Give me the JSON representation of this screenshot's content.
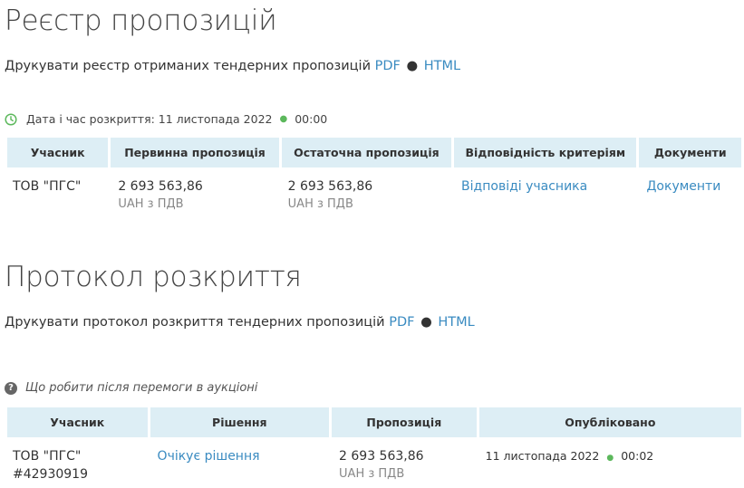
{
  "registry": {
    "title": "Реєстр пропозицій",
    "print_text": "Друкувати реєстр отриманих тендерних пропозицій",
    "pdf_label": "PDF",
    "html_label": "HTML",
    "opening_label": "Дата і час розкриття: 11 листопада 2022",
    "opening_time": "00:00",
    "columns": [
      "Учасник",
      "Первинна пропозиція",
      "Остаточна пропозиція",
      "Відповідність критеріям",
      "Документи"
    ],
    "rows": [
      {
        "participant": "ТОВ \"ПГС\"",
        "initial_amount": "2 693 563,86",
        "initial_currency": "UAH з ПДВ",
        "final_amount": "2 693 563,86",
        "final_currency": "UAH з ПДВ",
        "criteria_link": "Відповіді учасника",
        "documents_link": "Документи"
      }
    ]
  },
  "protocol": {
    "title": "Протокол розкриття",
    "print_text": "Друкувати протокол розкриття тендерних пропозицій",
    "pdf_label": "PDF",
    "html_label": "HTML",
    "help_text": "Що робити після перемоги в аукціоні",
    "columns": [
      "Учасник",
      "Рішення",
      "Пропозиція",
      "Опубліковано"
    ],
    "rows": [
      {
        "participant": "ТОВ \"ПГС\"",
        "participant_id": "#42930919",
        "decision_link": "Очікує рішення",
        "amount": "2 693 563,86",
        "currency": "UAH з ПДВ",
        "published_date": "11 листопада 2022",
        "published_time": "00:02"
      }
    ]
  },
  "colors": {
    "link": "#3a8bc1",
    "header_bg": "#ddeef5",
    "accent_green": "#5cb85c"
  }
}
